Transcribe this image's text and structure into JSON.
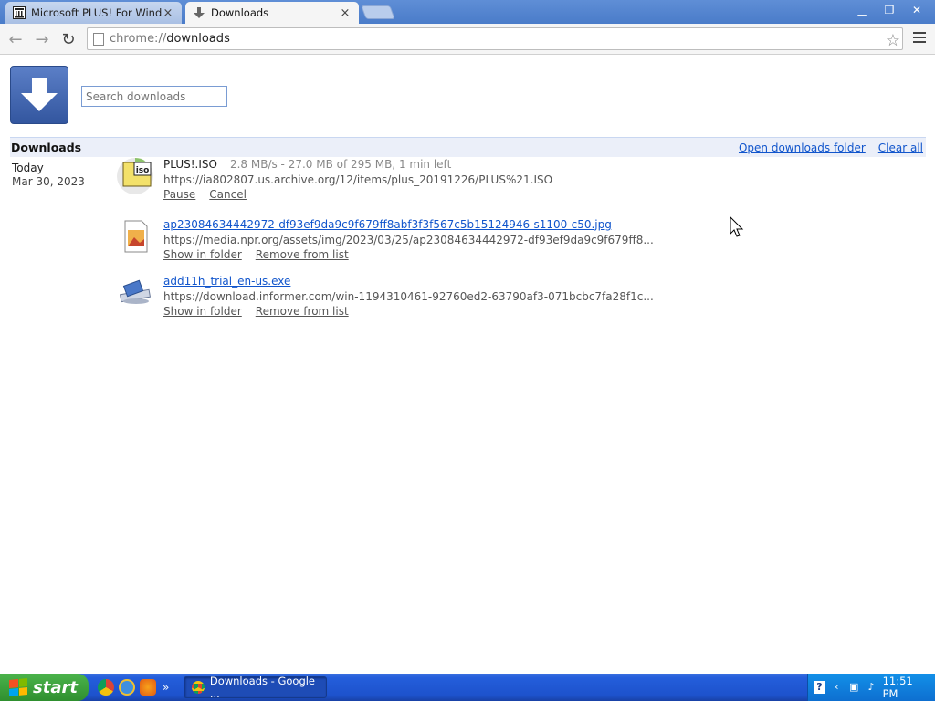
{
  "browser": {
    "tabs": [
      {
        "title": "Microsoft PLUS! For Window",
        "active": false
      },
      {
        "title": "Downloads",
        "active": true
      }
    ],
    "address": {
      "scheme": "chrome://",
      "host": "downloads"
    }
  },
  "page": {
    "search_placeholder": "Search downloads",
    "section_title": "Downloads",
    "open_folder_label": "Open downloads folder",
    "clear_all_label": "Clear all",
    "date_group": {
      "label": "Today",
      "date": "Mar 30, 2023"
    },
    "items": [
      {
        "name": "PLUS!.ISO",
        "status": "2.8 MB/s - 27.0 MB of 295 MB, 1 min left",
        "url": "https://ia802807.us.archive.org/12/items/plus_20191226/PLUS%21.ISO",
        "actions": [
          "Pause",
          "Cancel"
        ],
        "icon": "iso-file-icon",
        "progress": 0.0915
      },
      {
        "name": "ap23084634442972-df93ef9da9c9f679ff8abf3f3f567c5b15124946-s1100-c50.jpg",
        "url": "https://media.npr.org/assets/img/2023/03/25/ap23084634442972-df93ef9da9c9f679ff8...",
        "actions": [
          "Show in folder",
          "Remove from list"
        ],
        "icon": "image-file-icon"
      },
      {
        "name": "add11h_trial_en-us.exe",
        "url": "https://download.informer.com/win-1194310461-92760ed2-63790af3-071bcbc7fa28f1c...",
        "actions": [
          "Show in folder",
          "Remove from list"
        ],
        "icon": "exe-file-icon"
      }
    ]
  },
  "taskbar": {
    "start_label": "start",
    "task_label": "Downloads - Google ...",
    "clock": "11:51 PM"
  },
  "colors": {
    "link": "#1155cc",
    "tabstrip": "#4a7cc9",
    "taskbar": "#245edb",
    "start": "#3a9a3a"
  }
}
